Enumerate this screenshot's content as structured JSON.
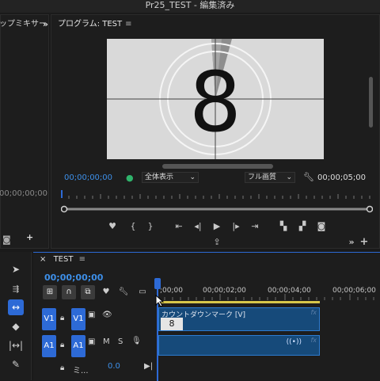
{
  "window_title": "Pr25_TEST - 編集済み",
  "left_panel": {
    "title": "ップミキサー",
    "more": "»",
    "timecode": "00;00;00;00"
  },
  "program": {
    "title": "プログラム: TEST",
    "menu_icon": "hamburger-icon",
    "countdown_digit": "8",
    "timecode_current": "00;00;00;00",
    "zoom_select": "全体表示",
    "quality_select": "フル画質",
    "timecode_duration": "00;00;05;00",
    "more": "»",
    "add": "+"
  },
  "transport": {
    "buttons": [
      "marker-icon",
      "in-point-icon",
      "out-point-icon",
      "go-to-in-icon",
      "step-back-icon",
      "play-icon",
      "step-forward-icon",
      "go-to-out-icon",
      "insert-icon",
      "overwrite-icon",
      "export-frame-icon",
      "lift-icon"
    ]
  },
  "timeline": {
    "tab_close": "×",
    "tab_label": "TEST",
    "tab_menu": "≡",
    "timecode": "00;00;00;00",
    "ruler_labels": [
      ";00;00",
      "00;00;02;00",
      "00;00;04;00",
      "00;00;06;00"
    ],
    "video_track": {
      "source": "V1",
      "target": "V1"
    },
    "audio_track": {
      "source": "A1",
      "target": "A1",
      "mute": "M",
      "solo": "S"
    },
    "clip_video_label": "カウントダウンマーク [V]",
    "clip_thumb_digit": "8",
    "fx_label": "fx",
    "master_label": "ミ...",
    "master_value": "0.0"
  },
  "colors": {
    "accent": "#2d6ad6",
    "timecode": "#3d8fe8",
    "clip": "#164a7a",
    "render_bar": "#d6c64a"
  }
}
